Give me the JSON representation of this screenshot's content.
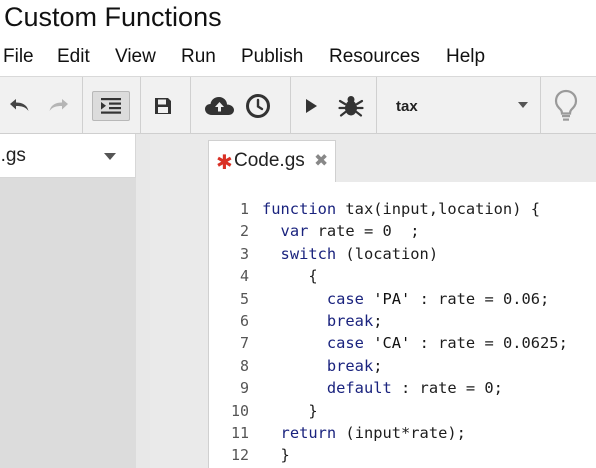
{
  "window": {
    "title": "Custom Functions"
  },
  "menu": {
    "items": [
      {
        "label": "File"
      },
      {
        "label": "Edit"
      },
      {
        "label": "View"
      },
      {
        "label": "Run"
      },
      {
        "label": "Publish"
      },
      {
        "label": "Resources"
      },
      {
        "label": "Help"
      }
    ]
  },
  "toolbar": {
    "buttons": [
      {
        "icon": "undo-icon"
      },
      {
        "icon": "redo-icon"
      },
      {
        "icon": "indent-icon",
        "active": true
      },
      {
        "icon": "save-icon"
      },
      {
        "icon": "cloud-upload-icon"
      },
      {
        "icon": "clock-trigger-icon"
      },
      {
        "icon": "run-icon"
      },
      {
        "icon": "debug-bug-icon"
      },
      {
        "icon": "lightbulb-icon"
      }
    ],
    "function_select": {
      "value": "tax"
    }
  },
  "sidebar": {
    "file_name": "e.gs"
  },
  "tabs": [
    {
      "label": "Code.gs",
      "modified_marker": "✱",
      "close": "✖"
    }
  ],
  "code": {
    "lines": [
      {
        "n": "1",
        "tokens": [
          [
            "kw",
            "function"
          ],
          [
            "plain",
            " tax(input,location) {"
          ]
        ]
      },
      {
        "n": "2",
        "tokens": [
          [
            "plain",
            "  "
          ],
          [
            "kw",
            "var"
          ],
          [
            "plain",
            " rate = 0  ;"
          ]
        ]
      },
      {
        "n": "3",
        "tokens": [
          [
            "plain",
            "  "
          ],
          [
            "kw",
            "switch"
          ],
          [
            "plain",
            " (location)"
          ]
        ]
      },
      {
        "n": "4",
        "tokens": [
          [
            "plain",
            "     {"
          ]
        ]
      },
      {
        "n": "5",
        "tokens": [
          [
            "plain",
            "       "
          ],
          [
            "kw",
            "case"
          ],
          [
            "plain",
            " "
          ],
          [
            "str",
            "'PA'"
          ],
          [
            "plain",
            " : rate = 0.06;"
          ]
        ]
      },
      {
        "n": "6",
        "tokens": [
          [
            "plain",
            "       "
          ],
          [
            "kw",
            "break"
          ],
          [
            "plain",
            ";"
          ]
        ]
      },
      {
        "n": "7",
        "tokens": [
          [
            "plain",
            "       "
          ],
          [
            "kw",
            "case"
          ],
          [
            "plain",
            " "
          ],
          [
            "str",
            "'CA'"
          ],
          [
            "plain",
            " : rate = 0.0625;"
          ]
        ]
      },
      {
        "n": "8",
        "tokens": [
          [
            "plain",
            "       "
          ],
          [
            "kw",
            "break"
          ],
          [
            "plain",
            ";"
          ]
        ]
      },
      {
        "n": "9",
        "tokens": [
          [
            "plain",
            "       "
          ],
          [
            "kw",
            "default"
          ],
          [
            "plain",
            " : rate = 0;"
          ]
        ]
      },
      {
        "n": "10",
        "tokens": [
          [
            "plain",
            "     }"
          ]
        ]
      },
      {
        "n": "11",
        "tokens": [
          [
            "plain",
            "  "
          ],
          [
            "kw",
            "return"
          ],
          [
            "plain",
            " (input*rate);"
          ]
        ]
      },
      {
        "n": "12",
        "tokens": [
          [
            "plain",
            "  }"
          ]
        ]
      }
    ]
  }
}
